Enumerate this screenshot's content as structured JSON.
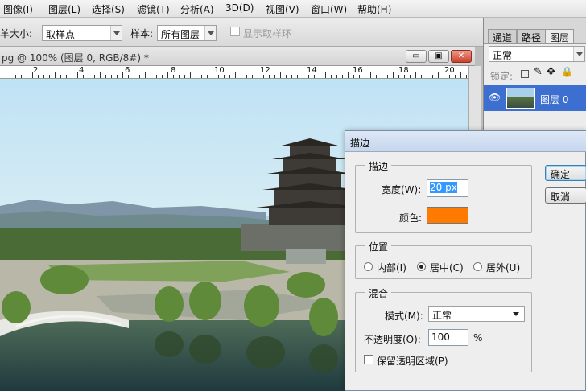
{
  "menubar": {
    "items": [
      "图像(I)",
      "图层(L)",
      "选择(S)",
      "滤镜(T)",
      "分析(A)",
      "3D(D)",
      "视图(V)",
      "窗口(W)",
      "帮助(H)"
    ]
  },
  "options": {
    "sample_size_label": "羊大小:",
    "sample_size_value": "取样点",
    "sample_label": "样本:",
    "sample_value": "所有图层",
    "show_ring_label": "显示取样环"
  },
  "document": {
    "title": "pg @ 100% (图层 0, RGB/8#) *",
    "min_icon": "▭",
    "restore_icon": "▣",
    "close_icon": "✕",
    "ruler_numbers": [
      "2",
      "4",
      "6",
      "8",
      "10",
      "12",
      "14",
      "16",
      "18",
      "20"
    ]
  },
  "layers_panel": {
    "tabs": [
      "通道",
      "路径",
      "图层"
    ],
    "blend_mode": "正常",
    "lock_label": "锁定:",
    "layer_name": "图层 0"
  },
  "stroke_dialog": {
    "title": "描边",
    "stroke_group": "描边",
    "width_label": "宽度(W):",
    "width_value": "20 px",
    "color_label": "颜色:",
    "color_value": "#ff7a00",
    "position_group": "位置",
    "inside_label": "内部(I)",
    "center_label": "居中(C)",
    "outside_label": "居外(U)",
    "blend_group": "混合",
    "mode_label": "模式(M):",
    "mode_value": "正常",
    "opacity_label": "不透明度(O):",
    "opacity_value": "100",
    "opacity_unit": "%",
    "preserve_label": "保留透明区域(P)",
    "ok_label": "确定",
    "cancel_label": "取消"
  }
}
